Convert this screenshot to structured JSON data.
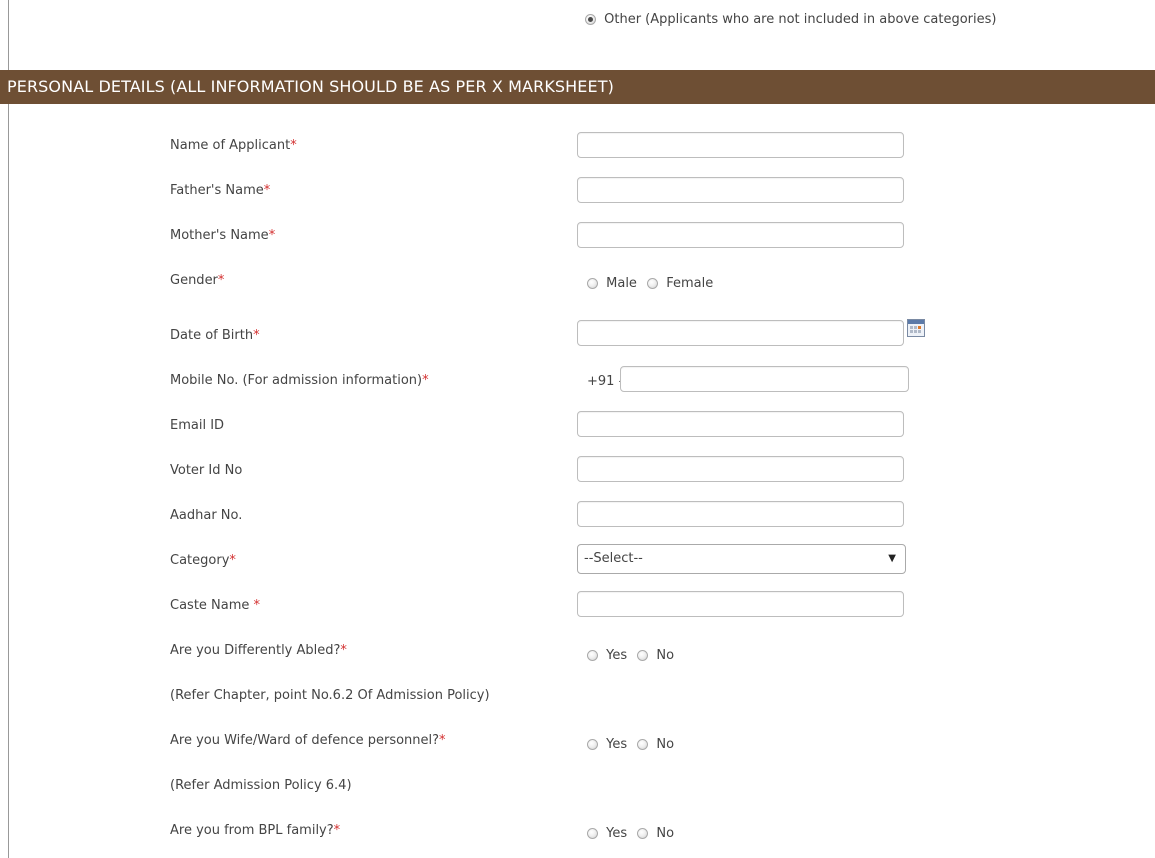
{
  "top_option": {
    "label": "Other (Applicants who are not included in above categories)",
    "selected": true
  },
  "section_header": "PERSONAL DETAILS (ALL INFORMATION SHOULD BE AS PER X MARKSHEET)",
  "fields": {
    "name": {
      "label": "Name of Applicant",
      "required_mark": "*",
      "value": ""
    },
    "father": {
      "label": "Father's Name",
      "required_mark": "*",
      "value": ""
    },
    "mother": {
      "label": "Mother's Name",
      "required_mark": "*",
      "value": ""
    },
    "gender": {
      "label": "Gender",
      "required_mark": "*",
      "options": [
        "Male",
        "Female"
      ]
    },
    "dob": {
      "label": "Date of Birth",
      "required_mark": "*",
      "value": "",
      "icon": "calendar-icon"
    },
    "mobile": {
      "label": "Mobile No. (For admission information)",
      "required_mark": "*",
      "prefix": "+91 -",
      "value": ""
    },
    "email": {
      "label": "Email ID",
      "value": ""
    },
    "voter": {
      "label": "Voter Id No",
      "value": ""
    },
    "aadhar": {
      "label": "Aadhar No.",
      "value": ""
    },
    "category": {
      "label": "Category",
      "required_mark": "*",
      "selected": "--Select--",
      "arrow": "▼"
    },
    "caste": {
      "label": "Caste Name ",
      "required_mark": "*",
      "value": ""
    },
    "disabled": {
      "label": "Are you Differently Abled?",
      "required_mark": "*",
      "options": [
        "Yes",
        "No"
      ],
      "note": "(Refer Chapter, point No.6.2 Of Admission Policy)"
    },
    "defence": {
      "label": "Are you Wife/Ward of defence personnel?",
      "required_mark": "*",
      "options": [
        "Yes",
        "No"
      ],
      "note": "(Refer Admission Policy 6.4)"
    },
    "bpl": {
      "label": "Are you from BPL family?",
      "required_mark": "*",
      "options": [
        "Yes",
        "No"
      ]
    }
  }
}
